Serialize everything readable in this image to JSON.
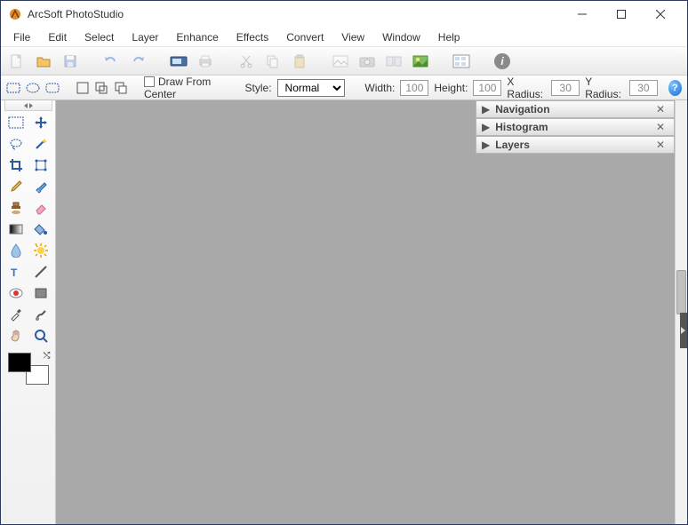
{
  "window": {
    "title": "ArcSoft PhotoStudio"
  },
  "menu": [
    "File",
    "Edit",
    "Select",
    "Layer",
    "Enhance",
    "Effects",
    "Convert",
    "View",
    "Window",
    "Help"
  ],
  "options": {
    "draw_from_center_label": "Draw From Center",
    "style_label": "Style:",
    "style_value": "Normal",
    "width_label": "Width:",
    "width_value": "100",
    "height_label": "Height:",
    "height_value": "100",
    "xradius_label": "X Radius:",
    "xradius_value": "30",
    "yradius_label": "Y Radius:",
    "yradius_value": "30"
  },
  "panels": {
    "nav": "Navigation",
    "hist": "Histogram",
    "layers": "Layers"
  },
  "swatch": {
    "fg": "#000000",
    "bg": "#ffffff"
  }
}
